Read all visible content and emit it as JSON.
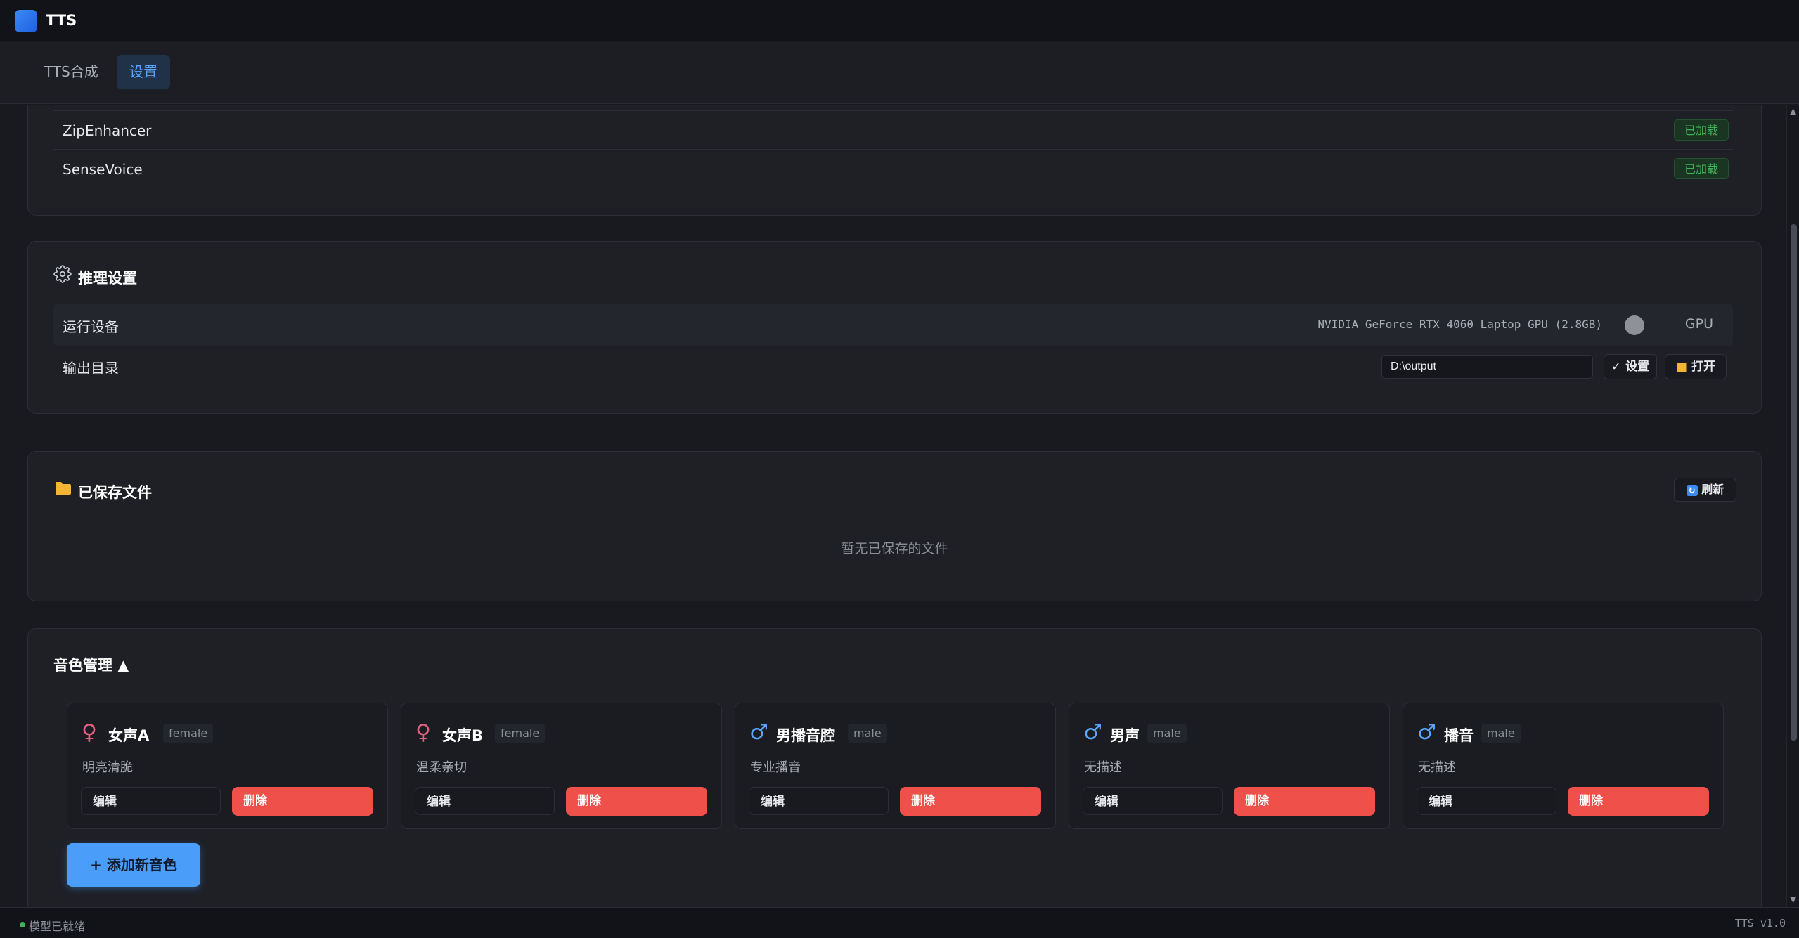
{
  "app": {
    "title": "TTS"
  },
  "tabs": [
    {
      "label": "TTS合成",
      "active": false
    },
    {
      "label": "设置",
      "active": true
    }
  ],
  "models": {
    "items": [
      {
        "name": "ZipEnhancer",
        "status": "已加载"
      },
      {
        "name": "SenseVoice",
        "status": "已加载"
      }
    ]
  },
  "inference": {
    "title": "推理设置",
    "device_label": "运行设备",
    "device_name": "NVIDIA GeForce RTX 4060 Laptop GPU (2.8GB)",
    "device_mode": "GPU",
    "output_label": "输出目录",
    "output_path": "D:\\output",
    "set_button": "✓ 设置",
    "open_button": "打开"
  },
  "saved_files": {
    "title": "已保存文件",
    "refresh_button": "刷新",
    "empty_text": "暂无已保存的文件"
  },
  "voices": {
    "title": "音色管理 ▲",
    "add_button": "+ 添加新音色",
    "edit_label": "编辑",
    "delete_label": "删除",
    "items": [
      {
        "name": "女声A",
        "gender": "female",
        "symbol": "♀",
        "description": "明亮清脆"
      },
      {
        "name": "女声B",
        "gender": "female",
        "symbol": "♀",
        "description": "温柔亲切"
      },
      {
        "name": "男播音腔",
        "gender": "male",
        "symbol": "♂",
        "description": "专业播音"
      },
      {
        "name": "男声",
        "gender": "male",
        "symbol": "♂",
        "description": "无描述"
      },
      {
        "name": "播音",
        "gender": "male",
        "symbol": "♂",
        "description": "无描述"
      }
    ]
  },
  "status": {
    "text": "模型已就绪",
    "version": "TTS v1.0"
  },
  "colors": {
    "accent": "#4b9dfa",
    "danger": "#f0504a",
    "success": "#3fb257",
    "female": "#e0607e",
    "male": "#5aa6ff"
  },
  "icons": {
    "gear": "gear-icon",
    "folder": "folder-icon",
    "refresh": "refresh-icon",
    "female": "female-symbol-icon",
    "male": "male-symbol-icon"
  }
}
